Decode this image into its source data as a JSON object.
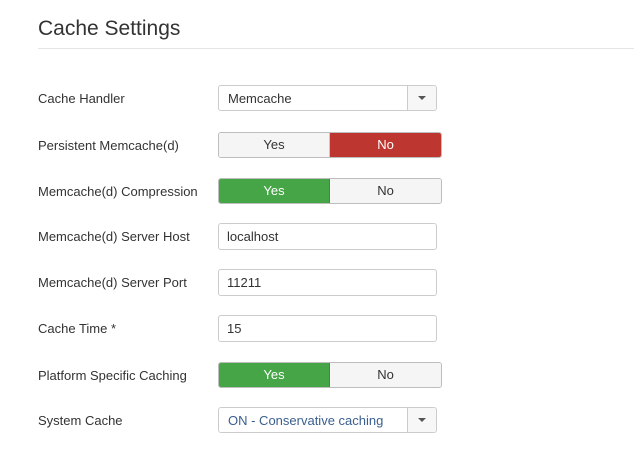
{
  "page": {
    "title": "Cache Settings"
  },
  "fields": {
    "cache_handler": {
      "label": "Cache Handler",
      "value": "Memcache"
    },
    "persistent_memcache": {
      "label": "Persistent Memcache(d)",
      "yes": "Yes",
      "no": "No",
      "selected": "No"
    },
    "memcache_compression": {
      "label": "Memcache(d) Compression",
      "yes": "Yes",
      "no": "No",
      "selected": "Yes"
    },
    "server_host": {
      "label": "Memcache(d) Server Host",
      "value": "localhost"
    },
    "server_port": {
      "label": "Memcache(d) Server Port",
      "value": "11211"
    },
    "cache_time": {
      "label": "Cache Time *",
      "value": "15"
    },
    "platform_caching": {
      "label": "Platform Specific Caching",
      "yes": "Yes",
      "no": "No",
      "selected": "Yes"
    },
    "system_cache": {
      "label": "System Cache",
      "value": "ON - Conservative caching"
    }
  },
  "colors": {
    "active_no": "#bd362f",
    "active_yes": "#46a546",
    "select_blue_text": "#3a5f8f"
  },
  "icons": {
    "dropdown": "chevron-down-icon"
  }
}
